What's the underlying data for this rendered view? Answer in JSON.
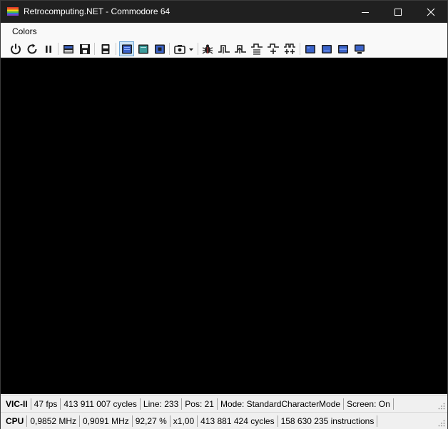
{
  "window": {
    "title": "Retrocomputing.NET - Commodore 64",
    "icon": "c64-rainbow-icon",
    "controls": [
      "minimize-icon",
      "maximize-icon",
      "close-icon"
    ]
  },
  "menu": {
    "items": [
      {
        "label": "Colors"
      }
    ]
  },
  "toolbar": {
    "groups": [
      [
        "power-icon",
        "reset-icon",
        "pause-icon"
      ],
      [
        "tape-icon",
        "disk-icon"
      ],
      [
        "cartridge-icon"
      ],
      [
        "monitor-blue-icon",
        "monitor-green-icon",
        "monitor-chip-icon"
      ],
      [
        "camera-dropdown-icon"
      ],
      [
        "bug-icon",
        "step-icon",
        "step-over-icon",
        "step-out-icon",
        "step-into-icon",
        "step-multi-icon"
      ],
      [
        "vic-icon",
        "sid-icon",
        "cia-icon",
        "display-icon"
      ]
    ],
    "selected": "monitor-blue-icon"
  },
  "status_vic": {
    "head": "VIC-II",
    "fps": "47 fps",
    "cycles": "413 911 007 cycles",
    "line": "Line: 233",
    "pos": "Pos: 21",
    "mode": "Mode: StandardCharacterMode",
    "screen": "Screen: On"
  },
  "status_cpu": {
    "head": "CPU",
    "freq1": "0,9852 MHz",
    "freq2": "0,9091 MHz",
    "percent": "92,27 %",
    "speed": "x1,00",
    "cycles": "413 881 424 cycles",
    "instructions": "158 630 235 instructions"
  },
  "colors": {
    "titlebar": "#202020",
    "screen": "#000000",
    "selected": "#cce4f7",
    "icon_blue": "#3b63c9",
    "icon_dark": "#1e1e1e"
  }
}
